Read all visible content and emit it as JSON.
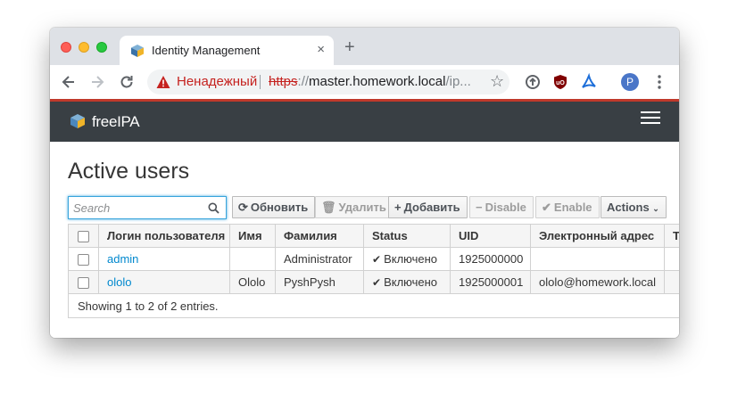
{
  "browser": {
    "tab_title": "Identity Management",
    "tab_close": "×",
    "new_tab": "+",
    "insecure_label": "Ненадежный",
    "url_scheme": "https",
    "url_sep": "://",
    "url_host": "master.homework.local",
    "url_path": "/ip...",
    "avatar_letter": "P"
  },
  "masthead": {
    "logo_text": "freeIPA"
  },
  "page": {
    "title": "Active users"
  },
  "search": {
    "placeholder": "Search"
  },
  "toolbar": {
    "refresh": "Обновить",
    "delete": "Удалить",
    "add": "Добавить",
    "disable": "Disable",
    "enable": "Enable",
    "actions": "Actions"
  },
  "table": {
    "columns": [
      "Логин пользователя",
      "Имя",
      "Фамилия",
      "Status",
      "UID",
      "Электронный адрес",
      "Т"
    ],
    "rows": [
      {
        "login": "admin",
        "first": "",
        "last": "Administrator",
        "status": "Включено",
        "uid": "1925000000",
        "email": "",
        "extra": ""
      },
      {
        "login": "ololo",
        "first": "Ololo",
        "last": "PyshPysh",
        "status": "Включено",
        "uid": "1925000001",
        "email": "ololo@homework.local",
        "extra": ""
      }
    ],
    "footer": "Showing 1 to 2 of 2 entries."
  },
  "colors": {
    "masthead": "#393f44",
    "link": "#0088ce",
    "accent_red": "#c0392b"
  }
}
